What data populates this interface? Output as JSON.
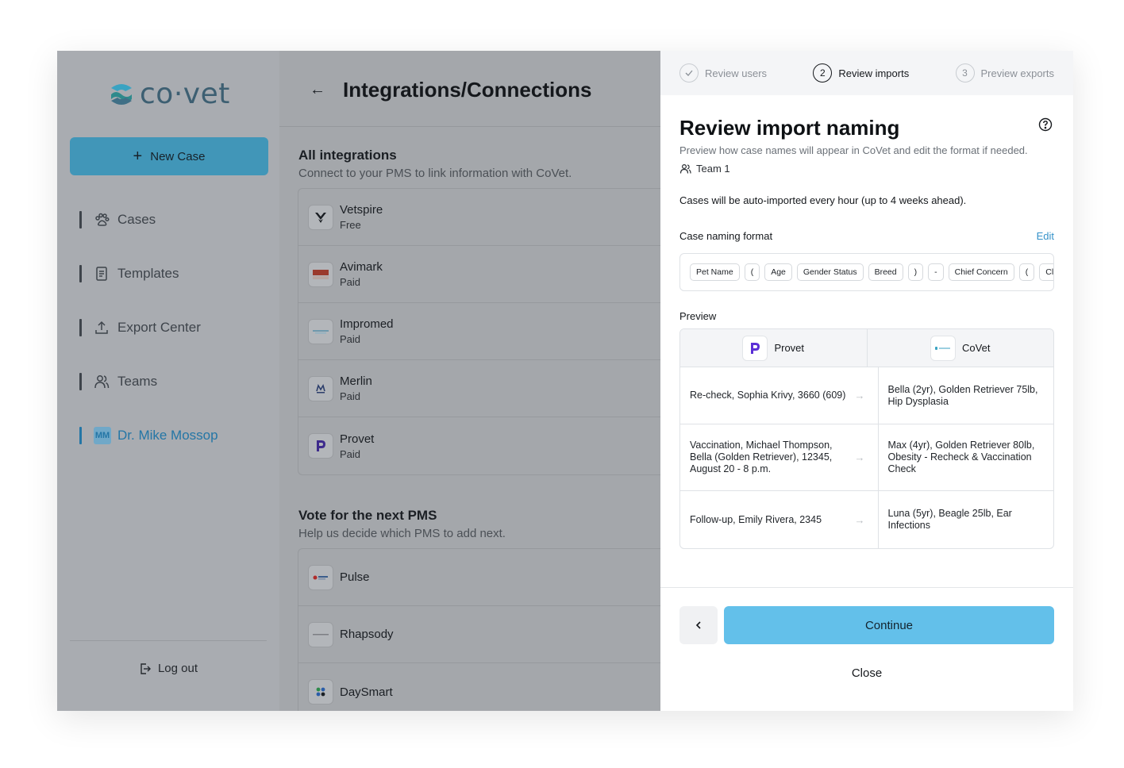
{
  "sidebar": {
    "logo_text": "co·vet",
    "new_case_label": "New Case",
    "items": [
      {
        "label": "Cases",
        "icon": "paw-icon"
      },
      {
        "label": "Templates",
        "icon": "document-icon"
      },
      {
        "label": "Export Center",
        "icon": "upload-icon"
      },
      {
        "label": "Teams",
        "icon": "users-icon"
      },
      {
        "label": "Dr. Mike Mossop",
        "icon": "avatar",
        "initials": "MM"
      }
    ],
    "logout_label": "Log out"
  },
  "main": {
    "title": "Integrations/Connections",
    "all_integrations": {
      "title": "All integrations",
      "subtitle": "Connect to your PMS to link information with CoVet.",
      "items": [
        {
          "name": "Vetspire",
          "tier": "Free"
        },
        {
          "name": "Avimark",
          "tier": "Paid"
        },
        {
          "name": "Impromed",
          "tier": "Paid"
        },
        {
          "name": "Merlin",
          "tier": "Paid"
        },
        {
          "name": "Provet",
          "tier": "Paid"
        }
      ]
    },
    "vote": {
      "title": "Vote for the next PMS",
      "subtitle": "Help us decide which PMS to add next.",
      "items": [
        {
          "name": "Pulse"
        },
        {
          "name": "Rhapsody"
        },
        {
          "name": "DaySmart"
        }
      ]
    }
  },
  "panel": {
    "steps": [
      {
        "label": "Review users",
        "number": "✓"
      },
      {
        "label": "Review imports",
        "number": "2"
      },
      {
        "label": "Preview exports",
        "number": "3"
      }
    ],
    "title": "Review import naming",
    "subtitle": "Preview how case names will appear in CoVet and edit the format if needed.",
    "team": "Team 1",
    "auto_note": "Cases will be auto-imported every hour (up to 4 weeks ahead).",
    "format_label": "Case naming format",
    "edit_label": "Edit",
    "format_chips": [
      "Pet Name",
      "(",
      "Age",
      "Gender Status",
      "Breed",
      ")",
      "-",
      "Chief Concern",
      "(",
      "Clie"
    ],
    "preview_label": "Preview",
    "preview_headers": {
      "left": "Provet",
      "right": "CoVet"
    },
    "preview_rows": [
      {
        "left": "Re-check, Sophia Krivy, 3660 (609)",
        "right": "Bella (2yr), Golden Retriever 75lb, Hip Dysplasia"
      },
      {
        "left": "Vaccination, Michael Thompson, Bella (Golden Retriever), 12345, August 20 - 8 p.m.",
        "right": "Max (4yr), Golden Retriever 80lb, Obesity - Recheck & Vaccination Check"
      },
      {
        "left": "Follow-up, Emily Rivera, 2345",
        "right": "Luna (5yr), Beagle 25lb, Ear Infections"
      }
    ],
    "continue_label": "Continue",
    "close_label": "Close"
  },
  "colors": {
    "accent": "#63c0ea",
    "sidebar_button": "#4196b8",
    "link": "#3592c9",
    "active_nav": "#2476a6"
  }
}
